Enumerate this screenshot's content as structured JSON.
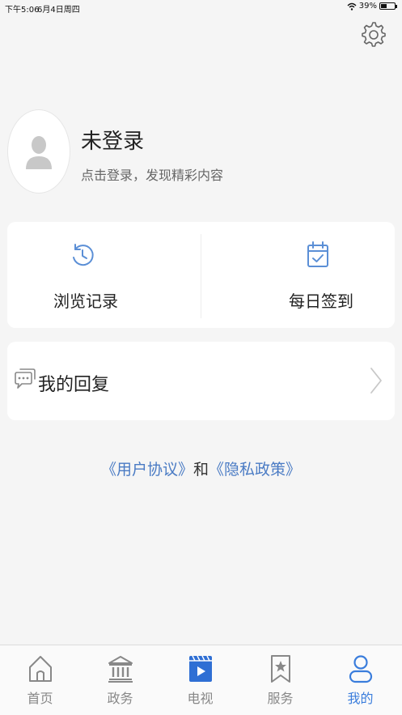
{
  "status_bar": {
    "time": "下午5:06",
    "date": "6月4日周四",
    "battery": "39%",
    "battery_level": 0.39
  },
  "profile": {
    "title": "未登录",
    "subtitle": "点击登录，发现精彩内容"
  },
  "actions": [
    {
      "label": "浏览记录",
      "icon": "history-icon"
    },
    {
      "label": "每日签到",
      "icon": "calendar-check-icon"
    }
  ],
  "reply": {
    "label": "我的回复",
    "icon": "chat-bubbles-icon"
  },
  "agreement": {
    "user_agreement": "《用户协议》",
    "and": "和",
    "privacy_policy": "《隐私政策》"
  },
  "tabs": [
    {
      "label": "首页",
      "icon": "home-icon",
      "active": false
    },
    {
      "label": "政务",
      "icon": "government-building-icon",
      "active": false
    },
    {
      "label": "电视",
      "icon": "tv-play-icon",
      "active": false
    },
    {
      "label": "服务",
      "icon": "bookmark-star-icon",
      "active": false
    },
    {
      "label": "我的",
      "icon": "user-icon",
      "active": true
    }
  ],
  "colors": {
    "accent": "#3a7ddc",
    "link": "#4a7bc4",
    "icon_blue": "#5b8fd6",
    "tv_blue": "#2f6fd4",
    "inactive": "#888888"
  }
}
